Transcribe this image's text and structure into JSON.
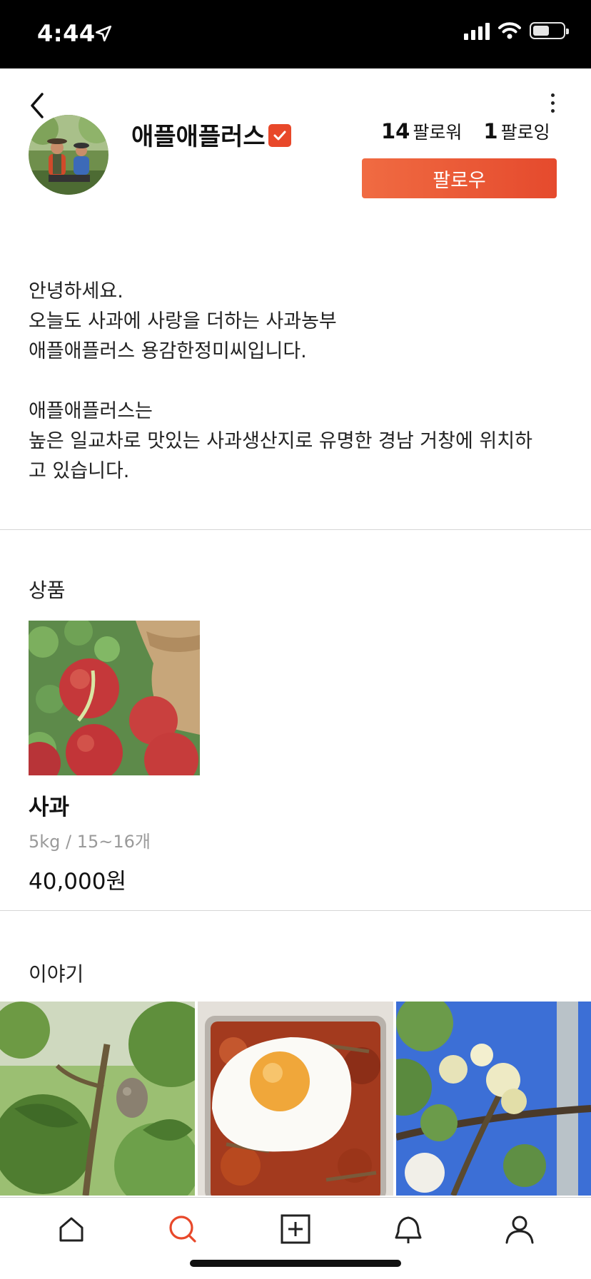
{
  "status_bar": {
    "time": "4:44"
  },
  "profile": {
    "name": "애플애플러스",
    "followers_count": "14",
    "followers_label": "팔로워",
    "following_count": "1",
    "following_label": "팔로잉",
    "follow_button": "팔로우"
  },
  "bio": {
    "line1": "안녕하세요.",
    "line2": "오늘도 사과에 사랑을 더하는 사과농부",
    "line3": "애플애플러스 용감한정미씨입니다.",
    "line4": "애플애플러스는",
    "line5": "높은 일교차로 맛있는 사과생산지로 유명한 경남 거창에 위치하",
    "line6": "고 있습니다."
  },
  "products_section": {
    "title": "상품",
    "items": [
      {
        "name": "사과",
        "spec": "5kg / 15~16개",
        "price": "40,000원"
      }
    ]
  },
  "stories_section": {
    "title": "이야기"
  },
  "colors": {
    "accent": "#e8482a",
    "follow_gradient_start": "#f06b42",
    "follow_gradient_end": "#e54a2d",
    "active_tab": "#e8482a"
  },
  "icons": {
    "back": "chevron-left-icon",
    "more": "more-vertical-icon",
    "verified": "verified-check-icon",
    "tabs": [
      "home-icon",
      "search-icon",
      "add-post-icon",
      "bell-icon",
      "profile-icon"
    ]
  }
}
